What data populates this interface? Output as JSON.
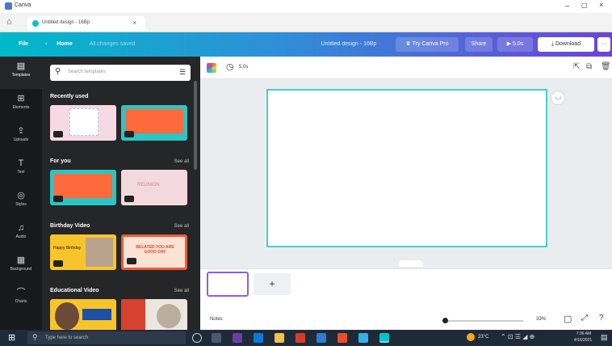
{
  "window": {
    "title": "Canva"
  },
  "browser": {
    "tab_title": "Untitled design - 16Bp",
    "close": "×",
    "new_tab": "+"
  },
  "header": {
    "file": "File",
    "home": "Home",
    "saved_status": "All changes saved",
    "design_name": "Untitled design - 16Bp",
    "try_pro": "Try Canva Pro",
    "share": "Share",
    "play": "5.0s",
    "download": "Download",
    "more": "···"
  },
  "rail": {
    "items": [
      {
        "label": "Templates",
        "icon": "template-icon"
      },
      {
        "label": "Elements",
        "icon": "elements-icon"
      },
      {
        "label": "Uploads",
        "icon": "upload-icon"
      },
      {
        "label": "Text",
        "icon": "text-icon"
      },
      {
        "label": "Styles",
        "icon": "styles-icon"
      },
      {
        "label": "Audio",
        "icon": "audio-icon"
      },
      {
        "label": "Background",
        "icon": "background-icon"
      },
      {
        "label": "Charts",
        "icon": "charts-icon"
      }
    ]
  },
  "panel": {
    "search_placeholder": "Search templates",
    "sections": [
      {
        "title": "Recently used",
        "see_all": ""
      },
      {
        "title": "For you",
        "see_all": "See all"
      },
      {
        "title": "Birthday Video",
        "see_all": "See all"
      },
      {
        "title": "Educational Video",
        "see_all": "See all"
      }
    ],
    "thumb_texts": {
      "reunion": "REUNION",
      "birthday": "BELATED YOU ARE GOOD DAY",
      "yellow": "Happy Birthday"
    }
  },
  "canvas": {
    "duration": "5.0s"
  },
  "pages": {
    "add": "+"
  },
  "footer": {
    "notes": "Notes",
    "zoom": "33%"
  },
  "taskbar": {
    "search_placeholder": "Type here to search",
    "weather": "23°C",
    "time": "7:36 AM",
    "date": "4/16/2021"
  },
  "colors": {
    "accent_teal": "#00b9c9",
    "accent_purple": "#6d44d8",
    "thumb_orange": "#ff6a3d",
    "page_border": "#3fd0d6"
  }
}
